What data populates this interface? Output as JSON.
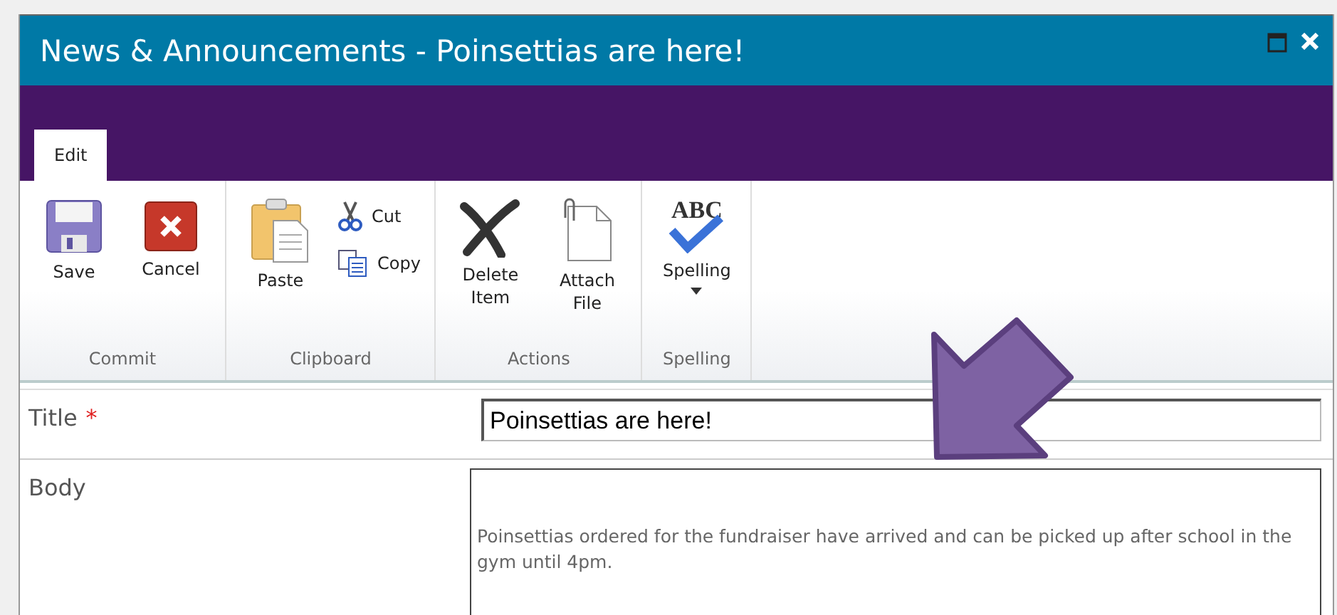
{
  "window": {
    "title": "News & Announcements - Poinsettias are here!"
  },
  "tabs": [
    {
      "label": "Edit",
      "selected": true
    }
  ],
  "ribbon": {
    "groups": [
      {
        "label": "Commit",
        "buttons": [
          {
            "kind": "large",
            "label": "Save"
          },
          {
            "kind": "large",
            "label": "Cancel"
          }
        ]
      },
      {
        "label": "Clipboard",
        "buttons": [
          {
            "kind": "large",
            "label": "Paste"
          },
          {
            "kind": "small",
            "label": "Cut"
          },
          {
            "kind": "small",
            "label": "Copy"
          }
        ]
      },
      {
        "label": "Actions",
        "buttons": [
          {
            "kind": "large",
            "label": "Delete Item"
          },
          {
            "kind": "large",
            "label": "Attach File"
          }
        ]
      },
      {
        "label": "Spelling",
        "buttons": [
          {
            "kind": "dropdown",
            "label": "Spelling",
            "icon_text": "ABC"
          }
        ]
      }
    ]
  },
  "form": {
    "fields": [
      {
        "kind": "text",
        "label": "Title",
        "required_mark": "*",
        "value": "Poinsettias are here!"
      },
      {
        "kind": "multiline",
        "label": "Body",
        "value": "Poinsettias ordered for the fundraiser have arrived and can be picked up after school in the gym until 4pm."
      }
    ]
  }
}
